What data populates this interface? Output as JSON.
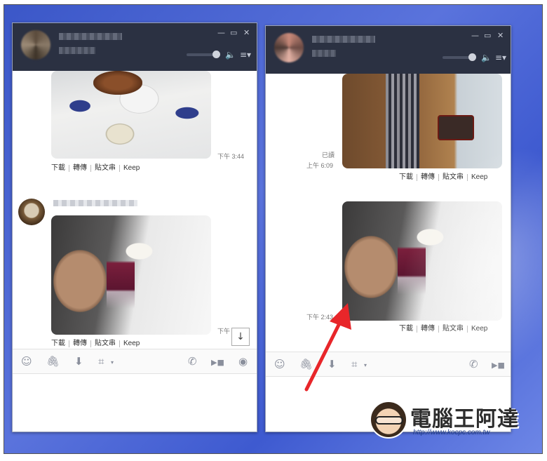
{
  "left_window": {
    "controls": {
      "minimize": "—",
      "maximize": "▭",
      "close": "✕"
    },
    "messages": [
      {
        "time": "下午 3:44"
      },
      {
        "time": "下午"
      }
    ],
    "actions": [
      "下載",
      "轉傳",
      "貼文串",
      "Keep"
    ]
  },
  "right_window": {
    "controls": {
      "minimize": "—",
      "maximize": "▭",
      "close": "✕"
    },
    "messages": [
      {
        "read": "已讀",
        "time": "上午 6:09"
      },
      {
        "time": "下午 2:43"
      }
    ],
    "actions": [
      "下載",
      "轉傳",
      "貼文串",
      "Keep"
    ]
  },
  "toolbar_icons": {
    "emoji": "☺",
    "attach": "🖇",
    "download": "⬇",
    "crop": "⌗",
    "caret": "▾",
    "call": "✆",
    "video": "▶■",
    "live": "◉"
  },
  "scroll_down_glyph": "↓",
  "logo": {
    "name": "電腦王阿達",
    "url": "http://www.kocpc.com.tw"
  },
  "colors": {
    "titlebar": "#2b3142",
    "desktop": "#4a64d4",
    "arrow": "#e8262a"
  }
}
